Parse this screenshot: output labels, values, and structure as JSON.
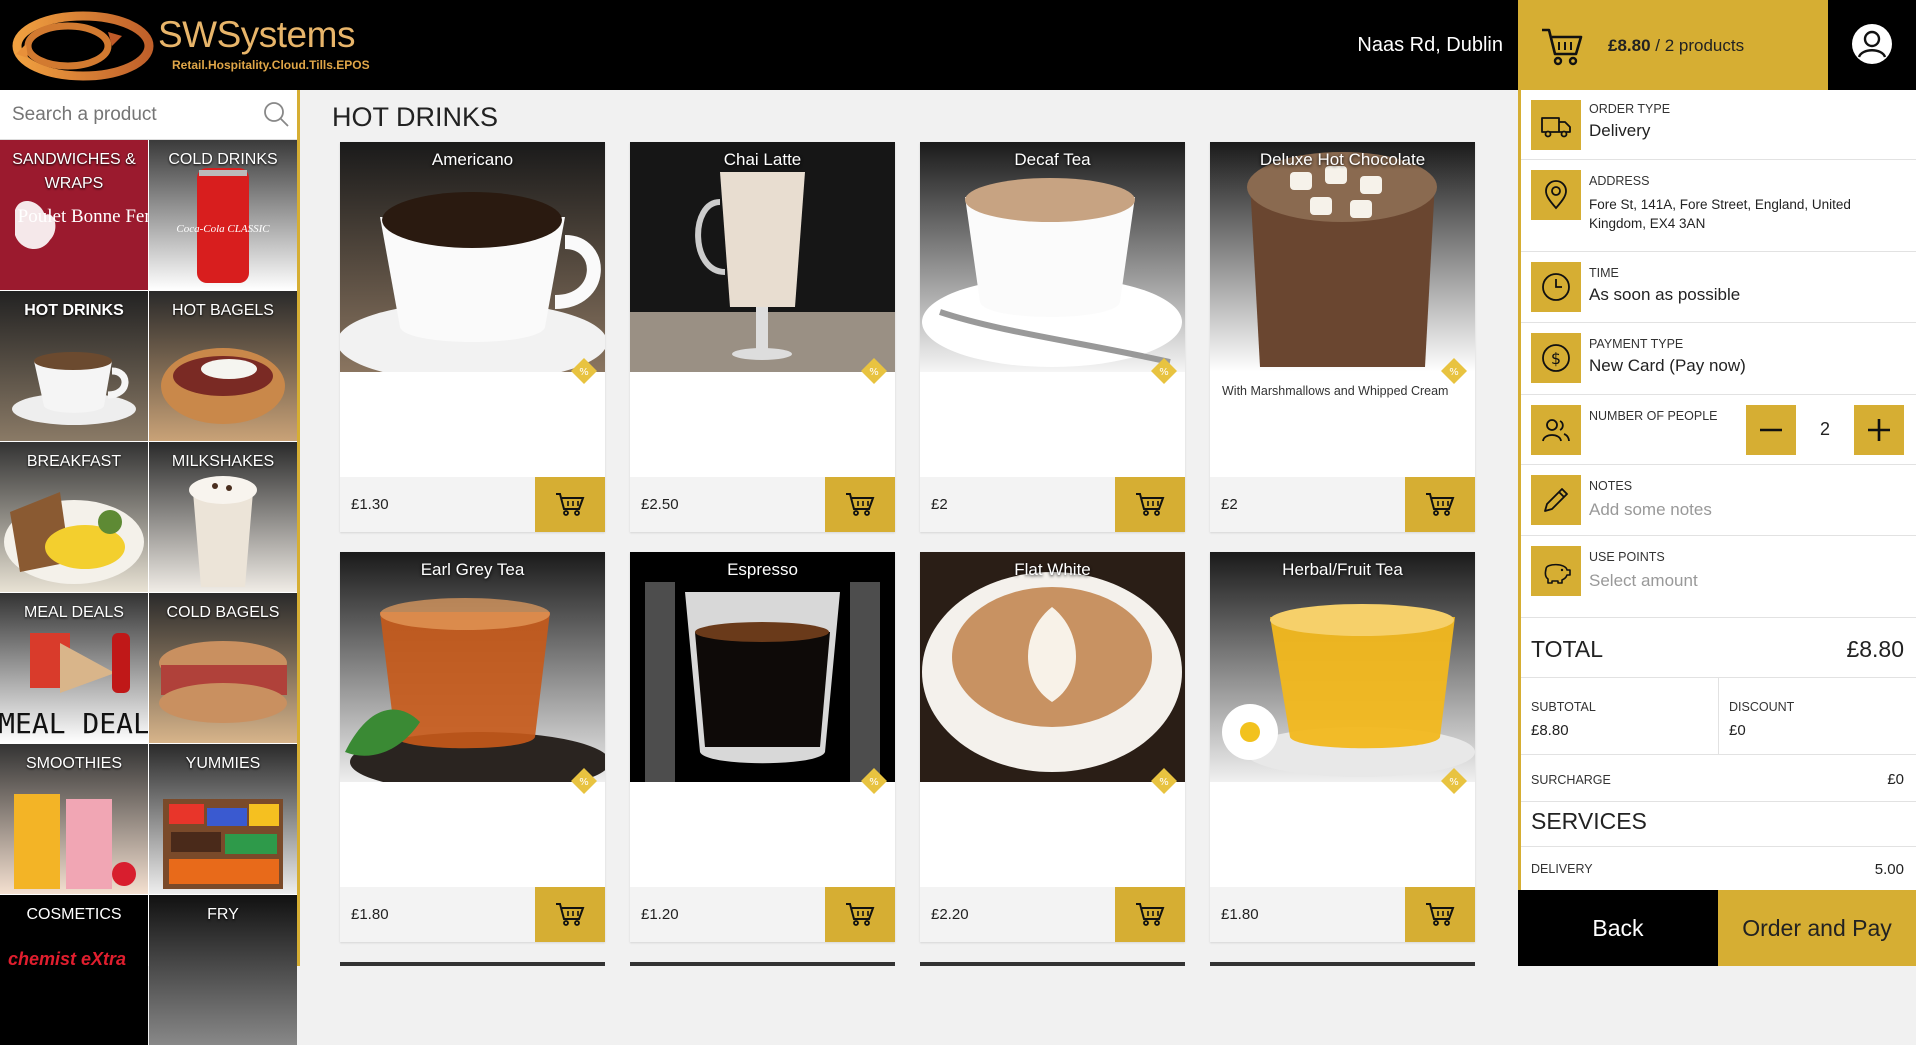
{
  "header": {
    "brand": "SWSystems",
    "tagline": "Retail.Hospitality.Cloud.Tills.EPOS",
    "location": "Naas Rd, Dublin",
    "cart_amount": "£8.80",
    "cart_sep": " / ",
    "cart_count": "2 products"
  },
  "search": {
    "placeholder": "Search a product"
  },
  "categories": [
    {
      "label": "SANDWICHES & WRAPS",
      "art": "Poulet Bonne Femme"
    },
    {
      "label": "COLD DRINKS",
      "art": "Coca-Cola CLASSIC"
    },
    {
      "label": "HOT DRINKS"
    },
    {
      "label": "HOT BAGELS"
    },
    {
      "label": "BREAKFAST"
    },
    {
      "label": "MILKSHAKES"
    },
    {
      "label": "MEAL DEALS",
      "art": "MEAL DEAL"
    },
    {
      "label": "COLD BAGELS"
    },
    {
      "label": "SMOOTHIES"
    },
    {
      "label": "YUMMIES"
    },
    {
      "label": "COSMETICS",
      "art": "chemist eXtra"
    },
    {
      "label": "FRY"
    }
  ],
  "main": {
    "title": "HOT DRINKS",
    "products": [
      {
        "name": "Americano",
        "desc": "",
        "price": "£1.30"
      },
      {
        "name": "Chai Latte",
        "desc": "",
        "price": "£2.50"
      },
      {
        "name": "Decaf Tea",
        "desc": "",
        "price": "£2"
      },
      {
        "name": "Deluxe Hot Chocolate",
        "desc": "With Marshmallows and Whipped Cream",
        "price": "£2"
      },
      {
        "name": "Earl Grey Tea",
        "desc": "",
        "price": "£1.80"
      },
      {
        "name": "Espresso",
        "desc": "",
        "price": "£1.20"
      },
      {
        "name": "Flat White",
        "desc": "",
        "price": "£2.20"
      },
      {
        "name": "Herbal/Fruit Tea",
        "desc": "",
        "price": "£1.80"
      }
    ]
  },
  "order": {
    "order_type_label": "ORDER TYPE",
    "order_type": "Delivery",
    "address_label": "ADDRESS",
    "address": "Fore St, 141A, Fore Street, England, United Kingdom, EX4 3AN",
    "time_label": "TIME",
    "time": "As soon as possible",
    "payment_label": "PAYMENT TYPE",
    "payment": "New Card (Pay now)",
    "people_label": "NUMBER OF PEOPLE",
    "people": "2",
    "notes_label": "NOTES",
    "notes_placeholder": "Add some notes",
    "points_label": "USE POINTS",
    "points_placeholder": "Select amount",
    "total_label": "TOTAL",
    "total": "£8.80",
    "subtotal_label": "SUBTOTAL",
    "subtotal": "£8.80",
    "discount_label": "DISCOUNT",
    "discount": "£0",
    "surcharge_label": "SURCHARGE",
    "surcharge": "£0",
    "services_label": "SERVICES",
    "delivery_label": "DELIVERY",
    "delivery": "5.00"
  },
  "actions": {
    "back": "Back",
    "pay": "Order and Pay"
  },
  "colors": {
    "accent": "#d6ae33",
    "dark": "#000000"
  }
}
